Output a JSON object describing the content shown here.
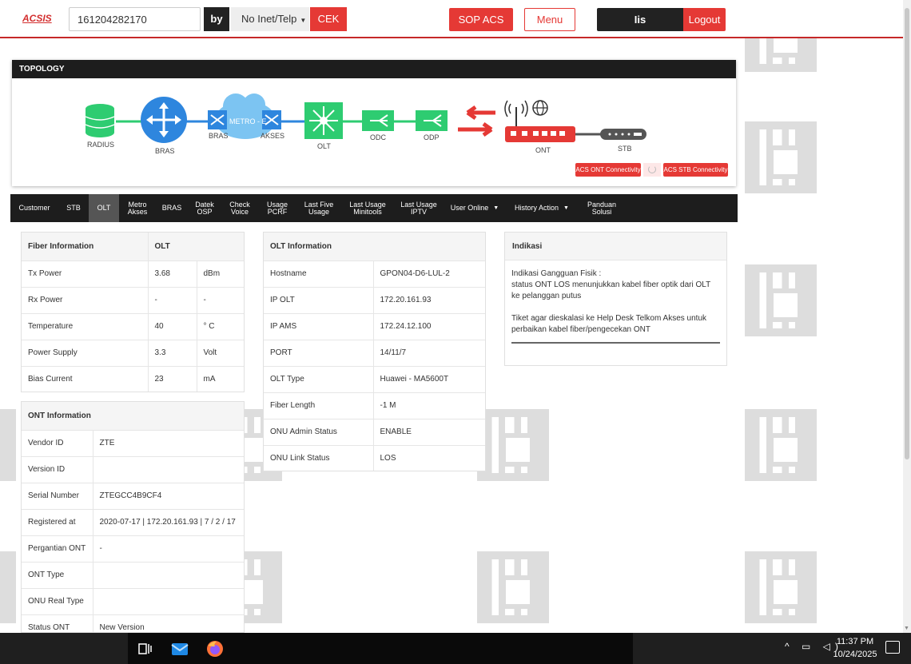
{
  "header": {
    "logo": "ACSIS",
    "search_value": "161204282170",
    "by_label": "by",
    "by_option": "No Inet/Telp",
    "cek_label": "CEK",
    "sop_label": "SOP ACS",
    "menu_label": "Menu",
    "user_name": "Iis Sulastriningsih",
    "logout_label": "Logout"
  },
  "topology": {
    "title": "TOPOLOGY",
    "nodes": {
      "radius": "RADIUS",
      "bras": "BRAS",
      "bras2": "BRAS",
      "metro": "METRO - E",
      "akses": "AKSES",
      "olt": "OLT",
      "odc": "ODC",
      "odp": "ODP",
      "ont": "ONT",
      "stb": "STB"
    },
    "acs_ont_label": "ACS ONT Connectivity",
    "acs_stb_label": "ACS STB Connectivity",
    "colors": {
      "green": "#2ecc71",
      "blue": "#2e86de",
      "red": "#e53935",
      "dark": "#555555"
    }
  },
  "tabs": [
    {
      "label": "Customer"
    },
    {
      "label": "STB"
    },
    {
      "label": "OLT"
    },
    {
      "label": "Metro Akses"
    },
    {
      "label": "BRAS"
    },
    {
      "label": "Datek OSP"
    },
    {
      "label": "Check Voice"
    },
    {
      "label": "Usage PCRF"
    },
    {
      "label": "Last Five Usage"
    },
    {
      "label": "Last Usage Minitools"
    },
    {
      "label": "Last Usage IPTV"
    },
    {
      "label": "User Online"
    },
    {
      "label": "History Action"
    },
    {
      "label": "Panduan Solusi"
    }
  ],
  "fiber_info": {
    "title": "Fiber Information",
    "col": "OLT",
    "rows": [
      {
        "label": "Tx Power",
        "value": "3.68",
        "unit": "dBm"
      },
      {
        "label": "Rx Power",
        "value": "-",
        "unit": "-"
      },
      {
        "label": "Temperature",
        "value": "40",
        "unit": "° C"
      },
      {
        "label": "Power Supply",
        "value": "3.3",
        "unit": "Volt"
      },
      {
        "label": "Bias Current",
        "value": "23",
        "unit": "mA"
      }
    ]
  },
  "ont_info": {
    "title": "ONT Information",
    "rows": [
      {
        "label": "Vendor ID",
        "value": "ZTE"
      },
      {
        "label": "Version ID",
        "value": ""
      },
      {
        "label": "Serial Number",
        "value": "ZTEGCC4B9CF4"
      },
      {
        "label": "Registered at",
        "value": "2020-07-17 | 172.20.161.93 | 7 / 2 / 17"
      },
      {
        "label": "Pergantian ONT",
        "value": "-"
      },
      {
        "label": "ONT Type",
        "value": ""
      },
      {
        "label": "ONU Real Type",
        "value": ""
      },
      {
        "label": "Status ONT",
        "value": "New Version"
      }
    ]
  },
  "olt_info": {
    "title": "OLT Information",
    "rows": [
      {
        "label": "Hostname",
        "value": "GPON04-D6-LUL-2"
      },
      {
        "label": "IP OLT",
        "value": "172.20.161.93"
      },
      {
        "label": "IP AMS",
        "value": "172.24.12.100"
      },
      {
        "label": "PORT",
        "value": "14/11/7"
      },
      {
        "label": "OLT Type",
        "value": "Huawei - MA5600T"
      },
      {
        "label": "Fiber Length",
        "value": "-1 M"
      },
      {
        "label": "ONU Admin Status",
        "value": "ENABLE"
      },
      {
        "label": "ONU Link Status",
        "value": "LOS"
      }
    ]
  },
  "indikasi": {
    "title": "Indikasi",
    "line1": "Indikasi Gangguan Fisik :",
    "line2": "status ONT LOS menunjukkan kabel fiber optik dari OLT ke pelanggan putus",
    "line3": "Tiket agar dieskalasi ke Help Desk Telkom Akses untuk perbaikan kabel fiber/pengecekan ONT"
  },
  "taskbar": {
    "time": "11:37 PM",
    "date": "10/24/2025"
  }
}
